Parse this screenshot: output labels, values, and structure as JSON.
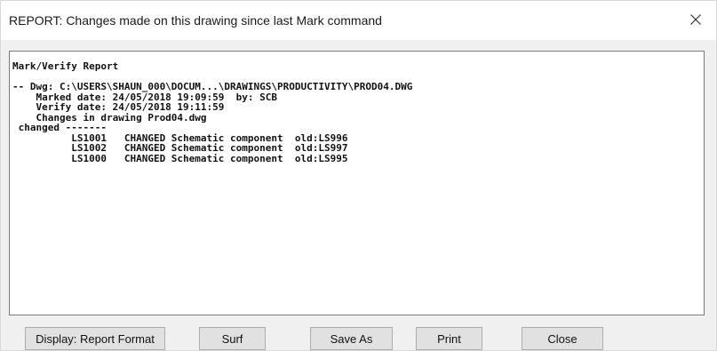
{
  "dialog": {
    "title": "REPORT: Changes made on this drawing since last Mark command",
    "close_glyph": "×"
  },
  "report": {
    "lines": [
      "Mark/Verify Report",
      "",
      "-- Dwg: C:\\USERS\\SHAUN_000\\DOCUM...\\DRAWINGS\\PRODUCTIVITY\\PROD04.DWG",
      "    Marked date: 24/05/2018 19:09:59  by: SCB",
      "    Verify date: 24/05/2018 19:11:59",
      "    Changes in drawing Prod04.dwg",
      " changed -------",
      "          LS1001   CHANGED Schematic component  old:LS996",
      "          LS1002   CHANGED Schematic component  old:LS997",
      "          LS1000   CHANGED Schematic component  old:LS995"
    ]
  },
  "buttons": {
    "display_format": "Display: Report Format",
    "surf": "Surf",
    "save_as": "Save As",
    "print": "Print",
    "close": "Close"
  }
}
